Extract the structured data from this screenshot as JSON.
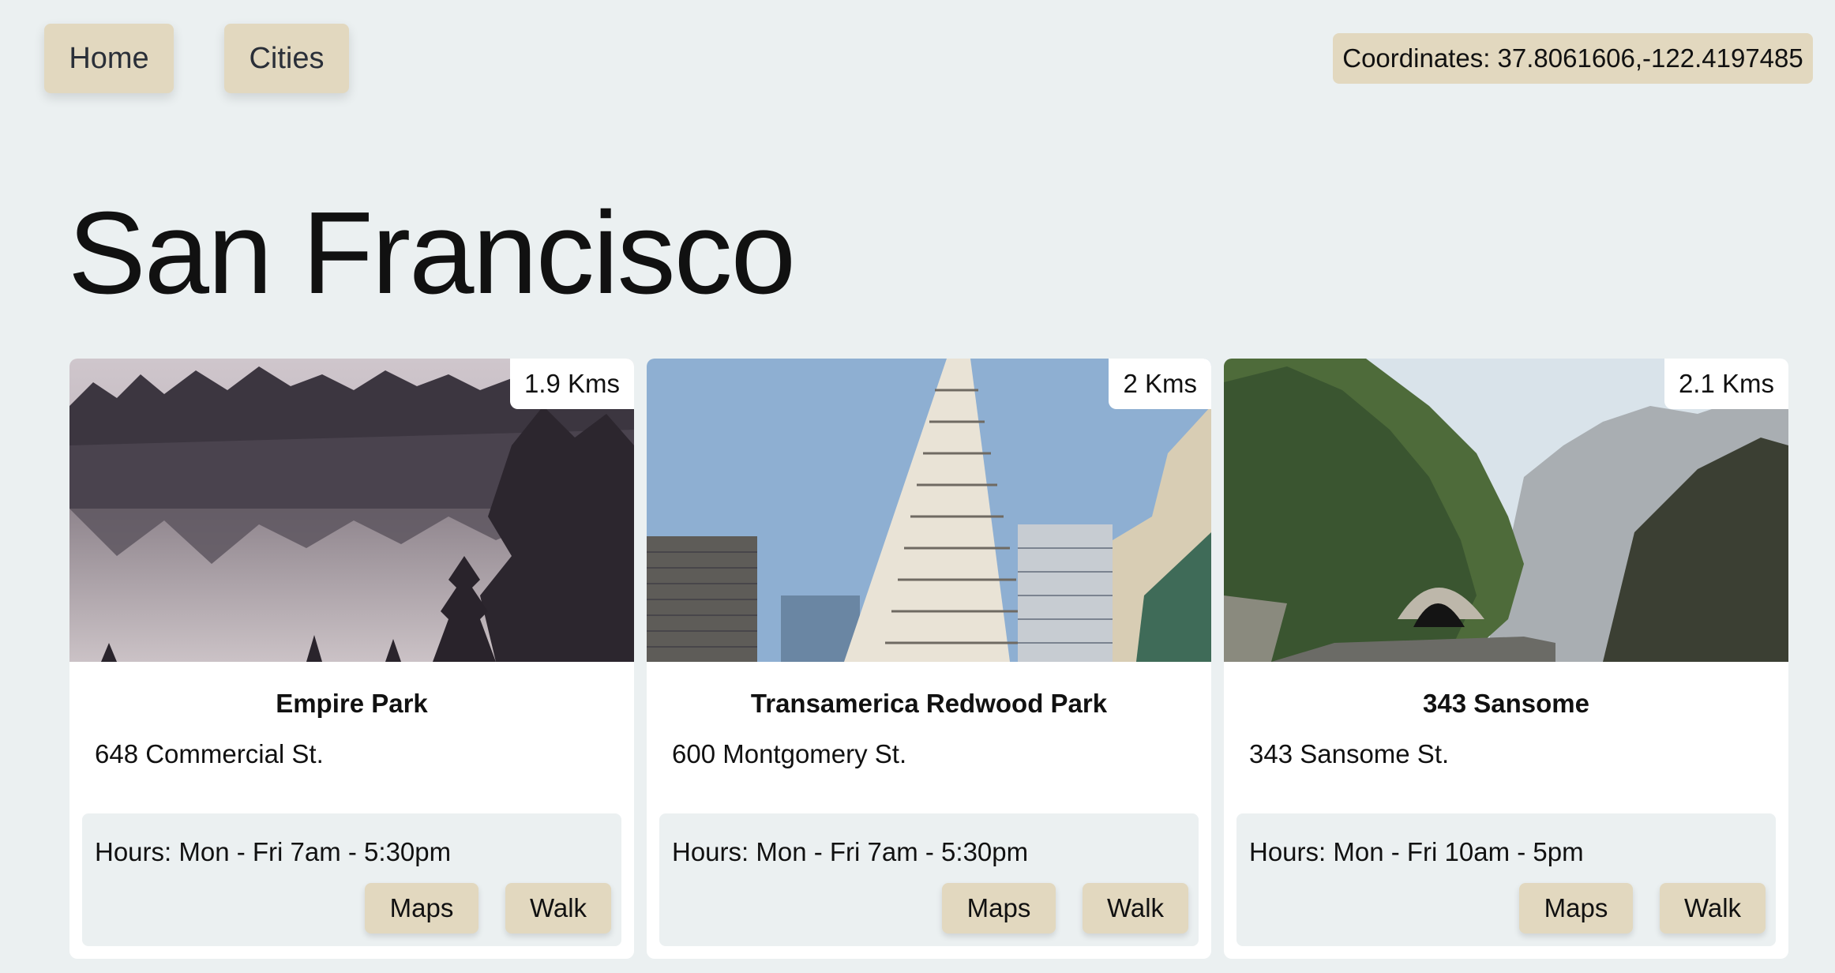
{
  "nav": {
    "home_label": "Home",
    "cities_label": "Cities"
  },
  "coordinates": "Coordinates: 37.8061606,-122.4197485",
  "page_title": "San Francisco",
  "places": [
    {
      "distance": "1.9 Kms",
      "name": "Empire Park",
      "address": "648 Commercial St.",
      "hours": "Hours: Mon - Fri 7am - 5:30pm",
      "maps_label": "Maps",
      "walk_label": "Walk"
    },
    {
      "distance": "2 Kms",
      "name": "Transamerica Redwood Park",
      "address": "600 Montgomery St.",
      "hours": "Hours: Mon - Fri 7am - 5:30pm",
      "maps_label": "Maps",
      "walk_label": "Walk"
    },
    {
      "distance": "2.1 Kms",
      "name": "343 Sansome",
      "address": "343 Sansome St.",
      "hours": "Hours: Mon - Fri 10am - 5pm",
      "maps_label": "Maps",
      "walk_label": "Walk"
    }
  ],
  "colors": {
    "background": "#ebf0f1",
    "button": "#e2d8bf",
    "card": "#ffffff"
  }
}
